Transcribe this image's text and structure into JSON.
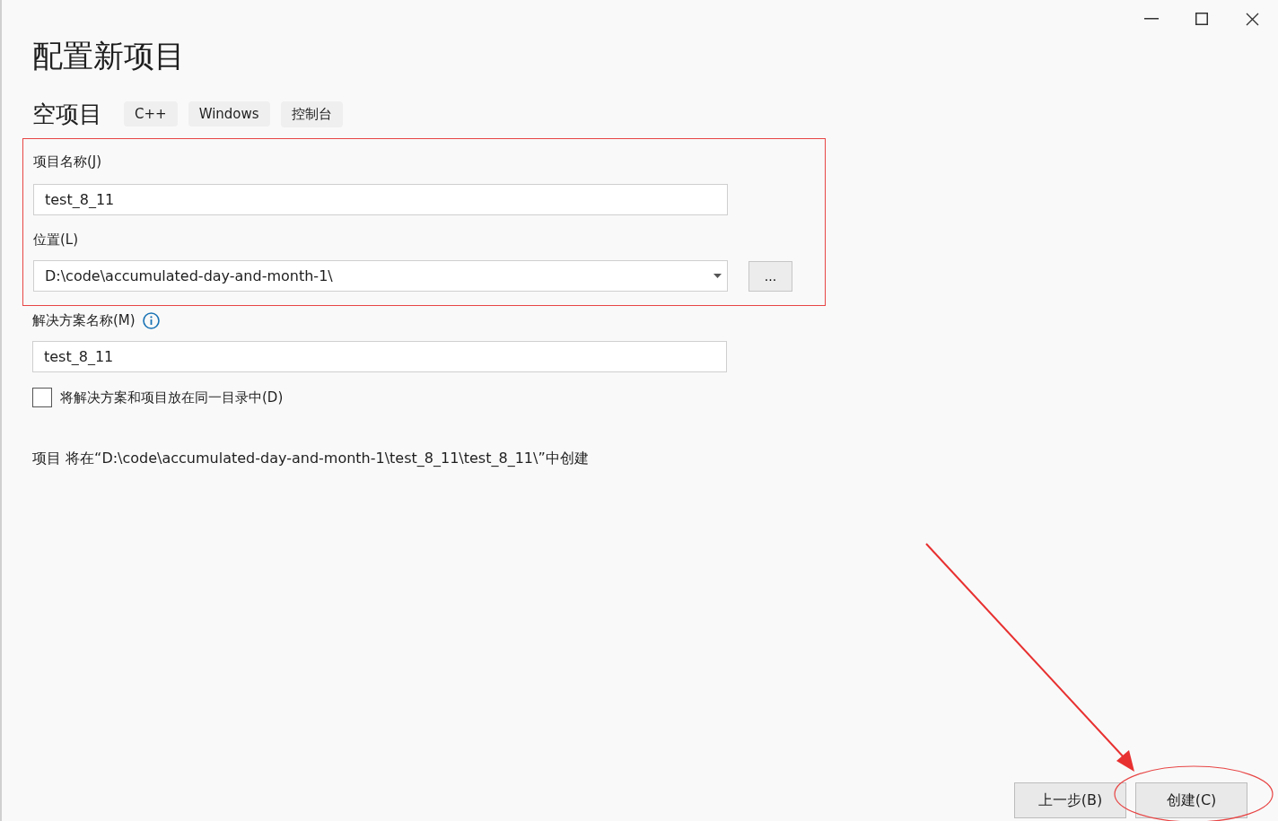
{
  "dialog": {
    "title": "配置新项目"
  },
  "template": {
    "name": "空项目",
    "tags": [
      "C++",
      "Windows",
      "控制台"
    ]
  },
  "project_name": {
    "label": "项目名称(J)",
    "value": "test_8_11"
  },
  "location": {
    "label": "位置(L)",
    "value": "D:\\code\\accumulated-day-and-month-1\\",
    "browse": "..."
  },
  "solution_name": {
    "label": "解决方案名称(M)",
    "value": "test_8_11"
  },
  "same_directory": {
    "label": "将解决方案和项目放在同一目录中(D)",
    "checked": false
  },
  "summary": "项目 将在“D:\\code\\accumulated-day-and-month-1\\test_8_11\\test_8_11\\”中创建",
  "buttons": [
    {
      "label": "上一步(B)"
    },
    {
      "label": "创建(C)"
    }
  ]
}
